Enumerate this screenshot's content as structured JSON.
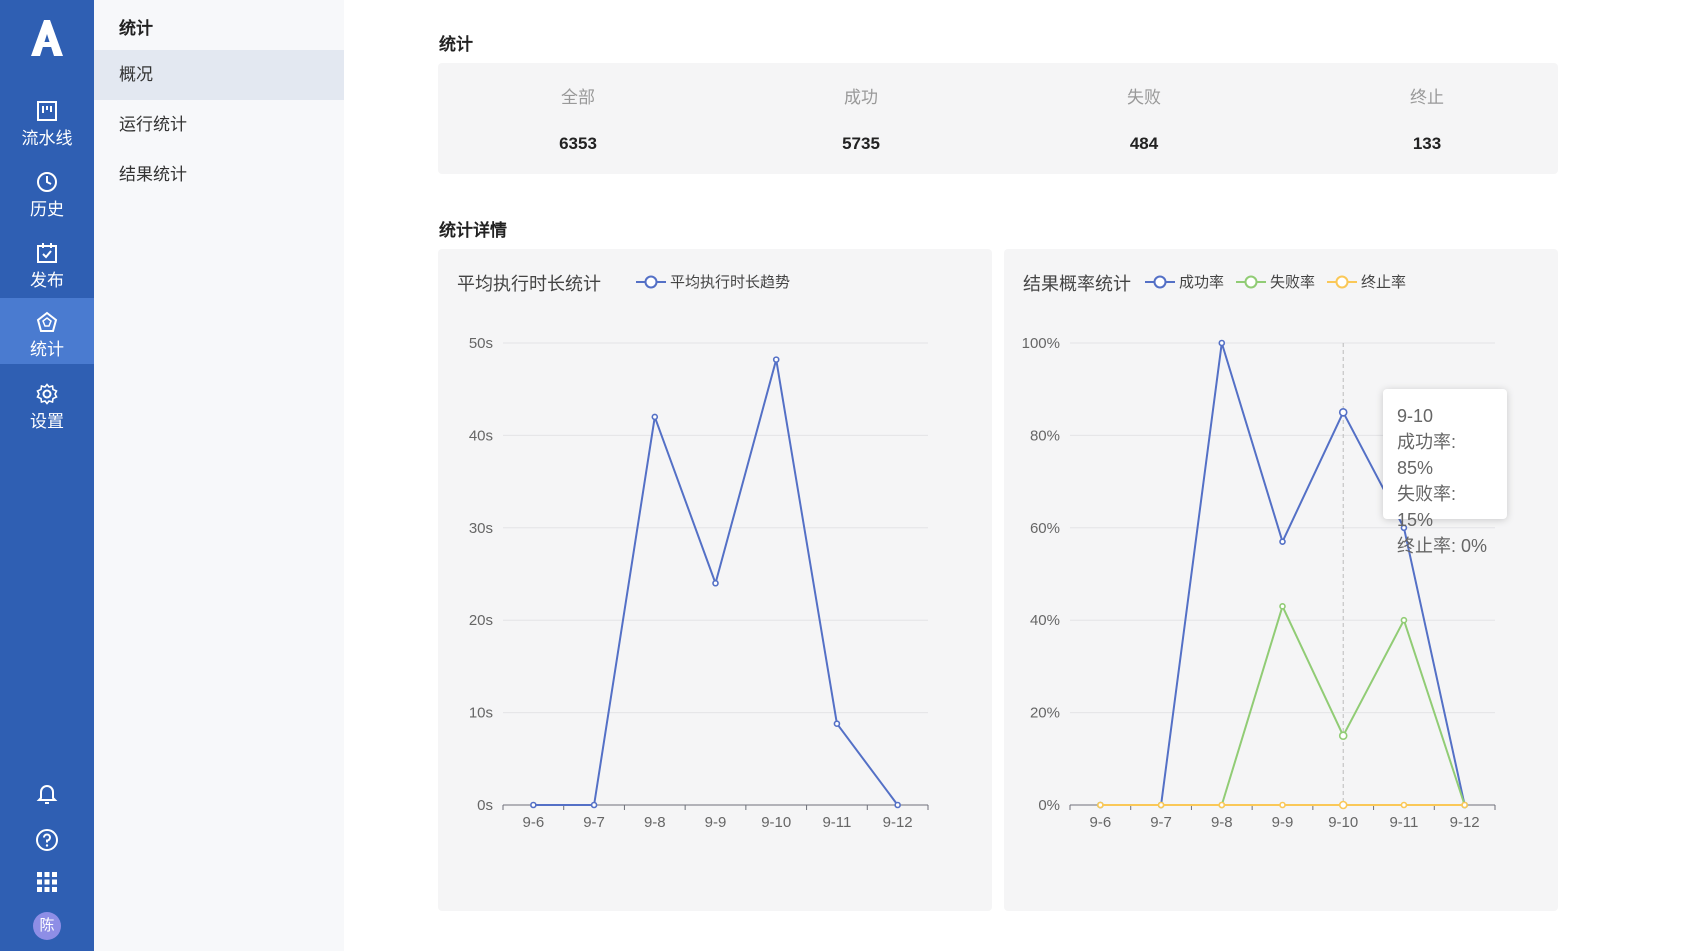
{
  "rail": {
    "items": [
      {
        "label": "流水线",
        "icon": "pipeline-icon"
      },
      {
        "label": "历史",
        "icon": "clock-icon"
      },
      {
        "label": "发布",
        "icon": "calendar-check-icon"
      },
      {
        "label": "统计",
        "icon": "pentagon-chart-icon"
      },
      {
        "label": "设置",
        "icon": "gear-icon"
      }
    ],
    "avatar": "陈"
  },
  "subnav": {
    "title": "统计",
    "items": [
      {
        "label": "概况"
      },
      {
        "label": "运行统计"
      },
      {
        "label": "结果统计"
      }
    ]
  },
  "summary": {
    "title": "统计",
    "stats": [
      {
        "label": "全部",
        "value": "6353"
      },
      {
        "label": "成功",
        "value": "5735"
      },
      {
        "label": "失败",
        "value": "484"
      },
      {
        "label": "终止",
        "value": "133"
      }
    ]
  },
  "details": {
    "title": "统计详情",
    "duration_panel": {
      "title": "平均执行时长统计"
    },
    "rate_panel": {
      "title": "结果概率统计"
    }
  },
  "tooltip": {
    "date": "9-10",
    "line1": "成功率: 85%",
    "line2": "失败率: 15%",
    "line3": "终止率: 0%"
  },
  "colors": {
    "primary": "#2f5fb3",
    "blue": "#5470c6",
    "green": "#91cc75",
    "yellow": "#fac858"
  },
  "chart_data": [
    {
      "type": "line",
      "title": "平均执行时长统计",
      "categories": [
        "9-6",
        "9-7",
        "9-8",
        "9-9",
        "9-10",
        "9-11",
        "9-12"
      ],
      "ylim": [
        0,
        50
      ],
      "yticks": [
        "0s",
        "10s",
        "20s",
        "30s",
        "40s",
        "50s"
      ],
      "series": [
        {
          "name": "平均执行时长趋势",
          "values": [
            0,
            0,
            42,
            24,
            48.2,
            8.8,
            0
          ]
        }
      ],
      "legend": "top"
    },
    {
      "type": "line",
      "title": "结果概率统计",
      "categories": [
        "9-6",
        "9-7",
        "9-8",
        "9-9",
        "9-10",
        "9-11",
        "9-12"
      ],
      "ylim": [
        0,
        100
      ],
      "yticks": [
        "0%",
        "20%",
        "40%",
        "60%",
        "80%",
        "100%"
      ],
      "series": [
        {
          "name": "成功率",
          "values": [
            0,
            0,
            100,
            57,
            85,
            60,
            0
          ]
        },
        {
          "name": "失败率",
          "values": [
            0,
            0,
            0,
            43,
            15,
            40,
            0
          ]
        },
        {
          "name": "终止率",
          "values": [
            0,
            0,
            0,
            0,
            0,
            0,
            0
          ]
        }
      ],
      "legend": "top"
    }
  ]
}
